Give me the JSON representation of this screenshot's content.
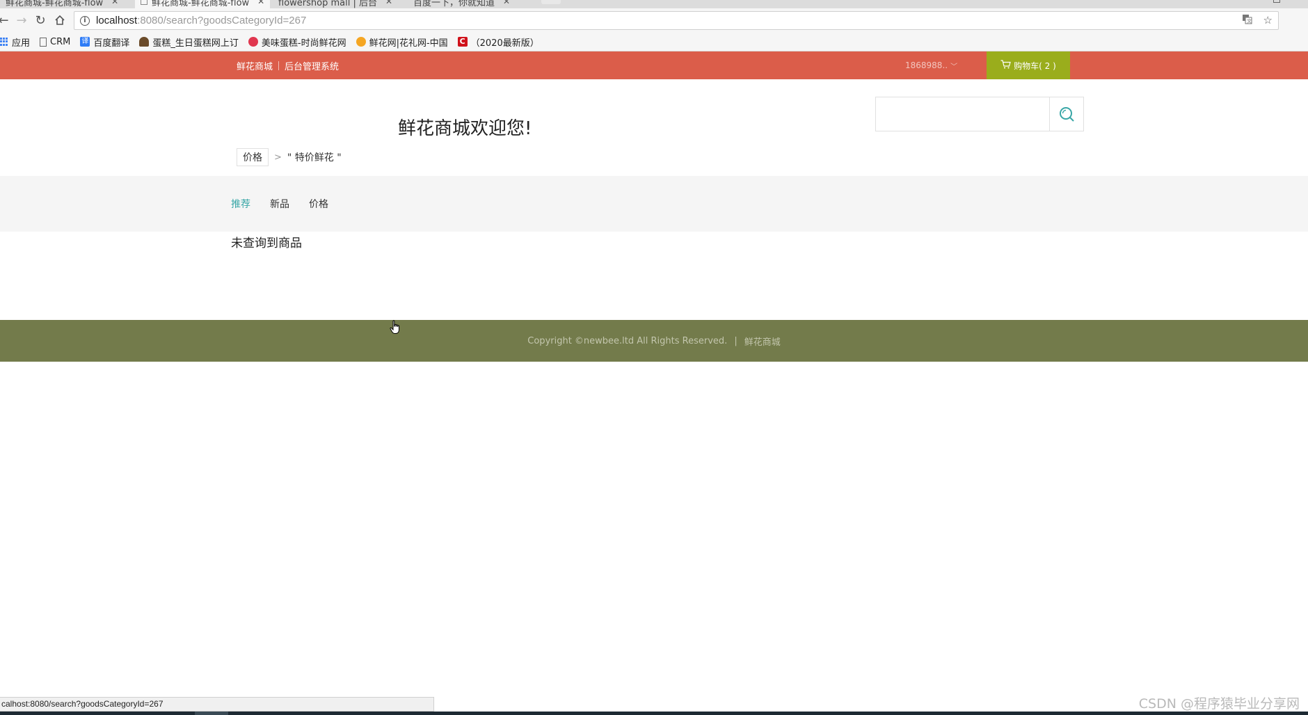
{
  "browser": {
    "tabs": [
      {
        "title": "鲜花商城-鲜花商城-flow",
        "active": false
      },
      {
        "title": "鲜花商城-鲜花商城-flow",
        "active": true
      },
      {
        "title": "flowershop mall | 后台",
        "active": false
      },
      {
        "title": "百度一下，你就知道",
        "active": false
      }
    ],
    "url_host": "localhost",
    "url_rest": ":8080/search?goodsCategoryId=267",
    "bookmarks": [
      {
        "label": "应用",
        "icon": "apps-icon"
      },
      {
        "label": "CRM",
        "icon": "page-icon"
      },
      {
        "label": "百度翻译",
        "icon": "translate-icon"
      },
      {
        "label": "蛋糕_生日蛋糕网上订",
        "icon": "cake-icon"
      },
      {
        "label": "美味蛋糕-时尚鲜花网",
        "icon": "flower-icon"
      },
      {
        "label": "鲜花网|花礼网-中国",
        "icon": "flower-icon"
      },
      {
        "label": "（2020最新版）",
        "icon": "c-icon"
      }
    ],
    "status_url": "calhost:8080/search?goodsCategoryId=267"
  },
  "header": {
    "site_link": "鲜花商城",
    "admin_link": "后台管理系统",
    "user_name": "1868988..",
    "cart_label": "购物车( 2 )",
    "brand_color": "#db5d4a",
    "cart_color": "#9aad1c"
  },
  "main": {
    "welcome": "鲜花商城欢迎您!",
    "search_placeholder": "",
    "breadcrumb": {
      "tag": "价格",
      "current": "\" 特价鲜花 \""
    },
    "sort_options": [
      {
        "label": "推荐",
        "active": true
      },
      {
        "label": "新品",
        "active": false
      },
      {
        "label": "价格",
        "active": false
      }
    ],
    "empty_message": "未查询到商品",
    "accent_color": "#38a6a6"
  },
  "footer": {
    "copyright": "Copyright ©newbee.ltd All Rights Reserved.",
    "separator": "|",
    "brand": "鲜花商城",
    "color": "#737b4b"
  },
  "watermark": "CSDN @程序猿毕业分享网"
}
